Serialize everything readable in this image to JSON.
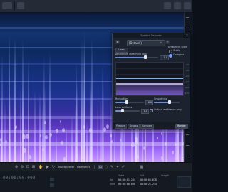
{
  "panel": {
    "window_title": "Spectral De-noise",
    "close_glyph": "×",
    "preset": "[Default]",
    "tab_learn": "Learn",
    "ambience_label": "Ambience Threshold (dB)",
    "ambience_value": "0.0",
    "ambience_level": 0.7,
    "mode_title": "Ambience type",
    "mode_static": "Static",
    "mode_complex": "Complex",
    "mode_selected": "Complex",
    "scale_labels": [
      "-20",
      "-40",
      "-60",
      "-80",
      "-100",
      "-120"
    ],
    "reduction_label": "Reduction",
    "reduction_value": "6.0",
    "reduction_level": 0.4,
    "smoothing_label": "Smoothing",
    "smoothing_value": "",
    "smoothing_level": 0.6,
    "quality_label": "Less artifacts",
    "quality_value": "0.0",
    "quality_level": 0.3,
    "output_checkbox_label": "Output ambience only",
    "output_checked": false,
    "buttons": {
      "preview": "Preview",
      "bypass": "Bypass",
      "compare": "Compare",
      "render": "Render"
    }
  },
  "transport": {
    "icons": [
      "zoom-in-icon",
      "zoom-out-icon",
      "zoom-fit-icon",
      "zoom-selection-icon",
      "hand-icon",
      "play-icon",
      "loop-icon"
    ],
    "mode_label": "Multispeaker",
    "mode_secondary": "Harmonics",
    "tool_icons": [
      "time-select-icon",
      "freq-select-icon",
      "lasso-icon",
      "brush-icon",
      "wand-icon",
      "pen-icon"
    ]
  },
  "status": {
    "time": "00:00:00.000",
    "start_label": "Start",
    "end_label": "End",
    "length_label": "Length",
    "sel_label": "Sel",
    "view_label": "View",
    "sel_start": "00:00:01.234",
    "sel_end": "00:00:05.678",
    "view_start": "00:00:00.000",
    "view_end": "00:00:21.234",
    "start_col": "Start",
    "end_col": "End",
    "length_col": "Length"
  }
}
